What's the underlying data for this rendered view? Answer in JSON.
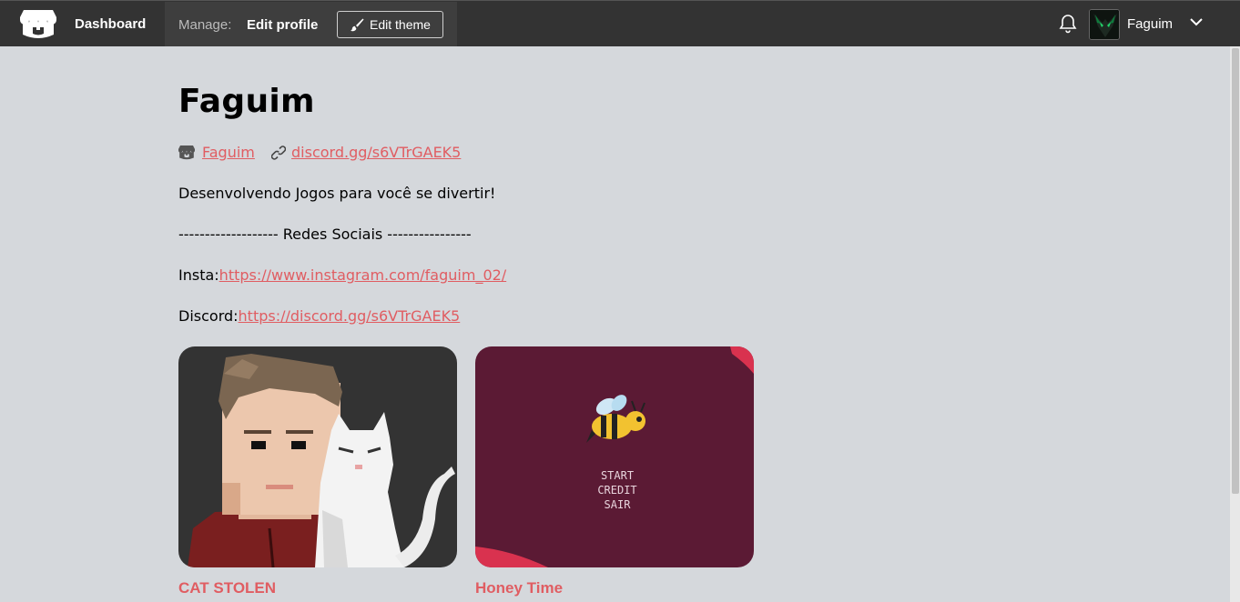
{
  "header": {
    "dashboard_label": "Dashboard",
    "manage_label": "Manage:",
    "edit_profile_label": "Edit profile",
    "edit_theme_label": "Edit theme",
    "username": "Faguim"
  },
  "profile": {
    "name": "Faguim",
    "itch_link": "Faguim",
    "discord_link": "discord.gg/s6VTrGAEK5",
    "bio_line1": "Desenvolvendo Jogos para você se divertir!",
    "bio_line2": "------------------- Redes Sociais  ----------------",
    "insta_prefix": "Insta:",
    "insta_url": "https://www.instagram.com/faguim_02/",
    "discord_prefix": "Discord:",
    "discord_url": "https://discord.gg/s6VTrGAEK5"
  },
  "games": [
    {
      "title": "CAT STOLEN"
    },
    {
      "title": "Honey Time",
      "menu": [
        "START",
        "CREDIT",
        "SAIR"
      ]
    }
  ],
  "colors": {
    "header_bg": "#333333",
    "page_bg": "#d5d8dc",
    "link": "#e05d62",
    "honey_bg": "#5b1a34"
  }
}
